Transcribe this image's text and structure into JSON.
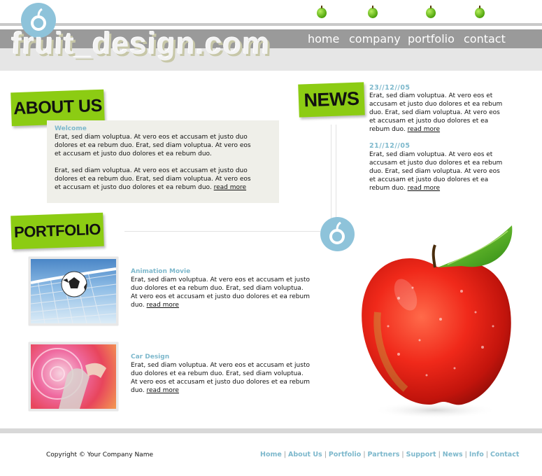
{
  "header": {
    "logo_text": "fruit_design.com",
    "nav": [
      {
        "label": "home"
      },
      {
        "label": "company"
      },
      {
        "label": "portfolio"
      },
      {
        "label": "contact"
      }
    ]
  },
  "about": {
    "heading": "ABOUT US",
    "title": "Welcome",
    "para1": "Erat, sed diam voluptua. At vero eos et accusam et justo duo dolores et ea rebum duo. Erat, sed diam voluptua. At vero eos et accusam et justo duo dolores et ea rebum duo.",
    "para2": "Erat, sed diam voluptua. At vero eos et accusam et justo duo dolores et ea rebum duo. Erat, sed diam voluptua. At vero eos et accusam et justo duo dolores et ea rebum duo.",
    "read_more": "read more"
  },
  "news": {
    "heading": "NEWS",
    "items": [
      {
        "date": "23//12//05",
        "text": "Erat, sed diam voluptua. At vero eos et accusam et justo duo dolores et ea rebum duo. Erat, sed diam voluptua. At vero eos et accusam et justo duo dolores et ea rebum duo.",
        "read_more": "read more"
      },
      {
        "date": "21//12//05",
        "text": "Erat, sed diam voluptua. At vero eos et accusam et justo duo dolores et ea rebum duo. Erat, sed diam voluptua. At vero eos et accusam et justo duo dolores et ea rebum duo.",
        "read_more": "read more"
      }
    ]
  },
  "portfolio": {
    "heading": "PORTFOLIO",
    "items": [
      {
        "title": "Animation Movie",
        "text": "Erat, sed diam voluptua. At vero eos et accusam et justo duo dolores et ea rebum duo. Erat, sed diam voluptua. At vero eos et accusam et justo duo dolores et ea rebum duo.",
        "read_more": "read more"
      },
      {
        "title": "Car Design",
        "text": "Erat, sed diam voluptua. At vero eos et accusam et justo duo dolores et ea rebum duo. Erat, sed diam voluptua. At vero eos et accusam et justo duo dolores et ea rebum duo.",
        "read_more": "read more"
      }
    ]
  },
  "footer": {
    "copyright": "Copyright © Your Company Name",
    "links": [
      {
        "label": "Home"
      },
      {
        "label": "About Us"
      },
      {
        "label": "Portfolio"
      },
      {
        "label": "Partners"
      },
      {
        "label": "Support"
      },
      {
        "label": "News"
      },
      {
        "label": "Info"
      },
      {
        "label": "Contact"
      }
    ]
  },
  "colors": {
    "accent_green": "#8ccc13",
    "accent_blue": "#7db8cc",
    "bar_gray": "#9a9a9a"
  },
  "icons": [
    "apple-logo-icon",
    "green-apple-icon",
    "red-apple-image"
  ]
}
